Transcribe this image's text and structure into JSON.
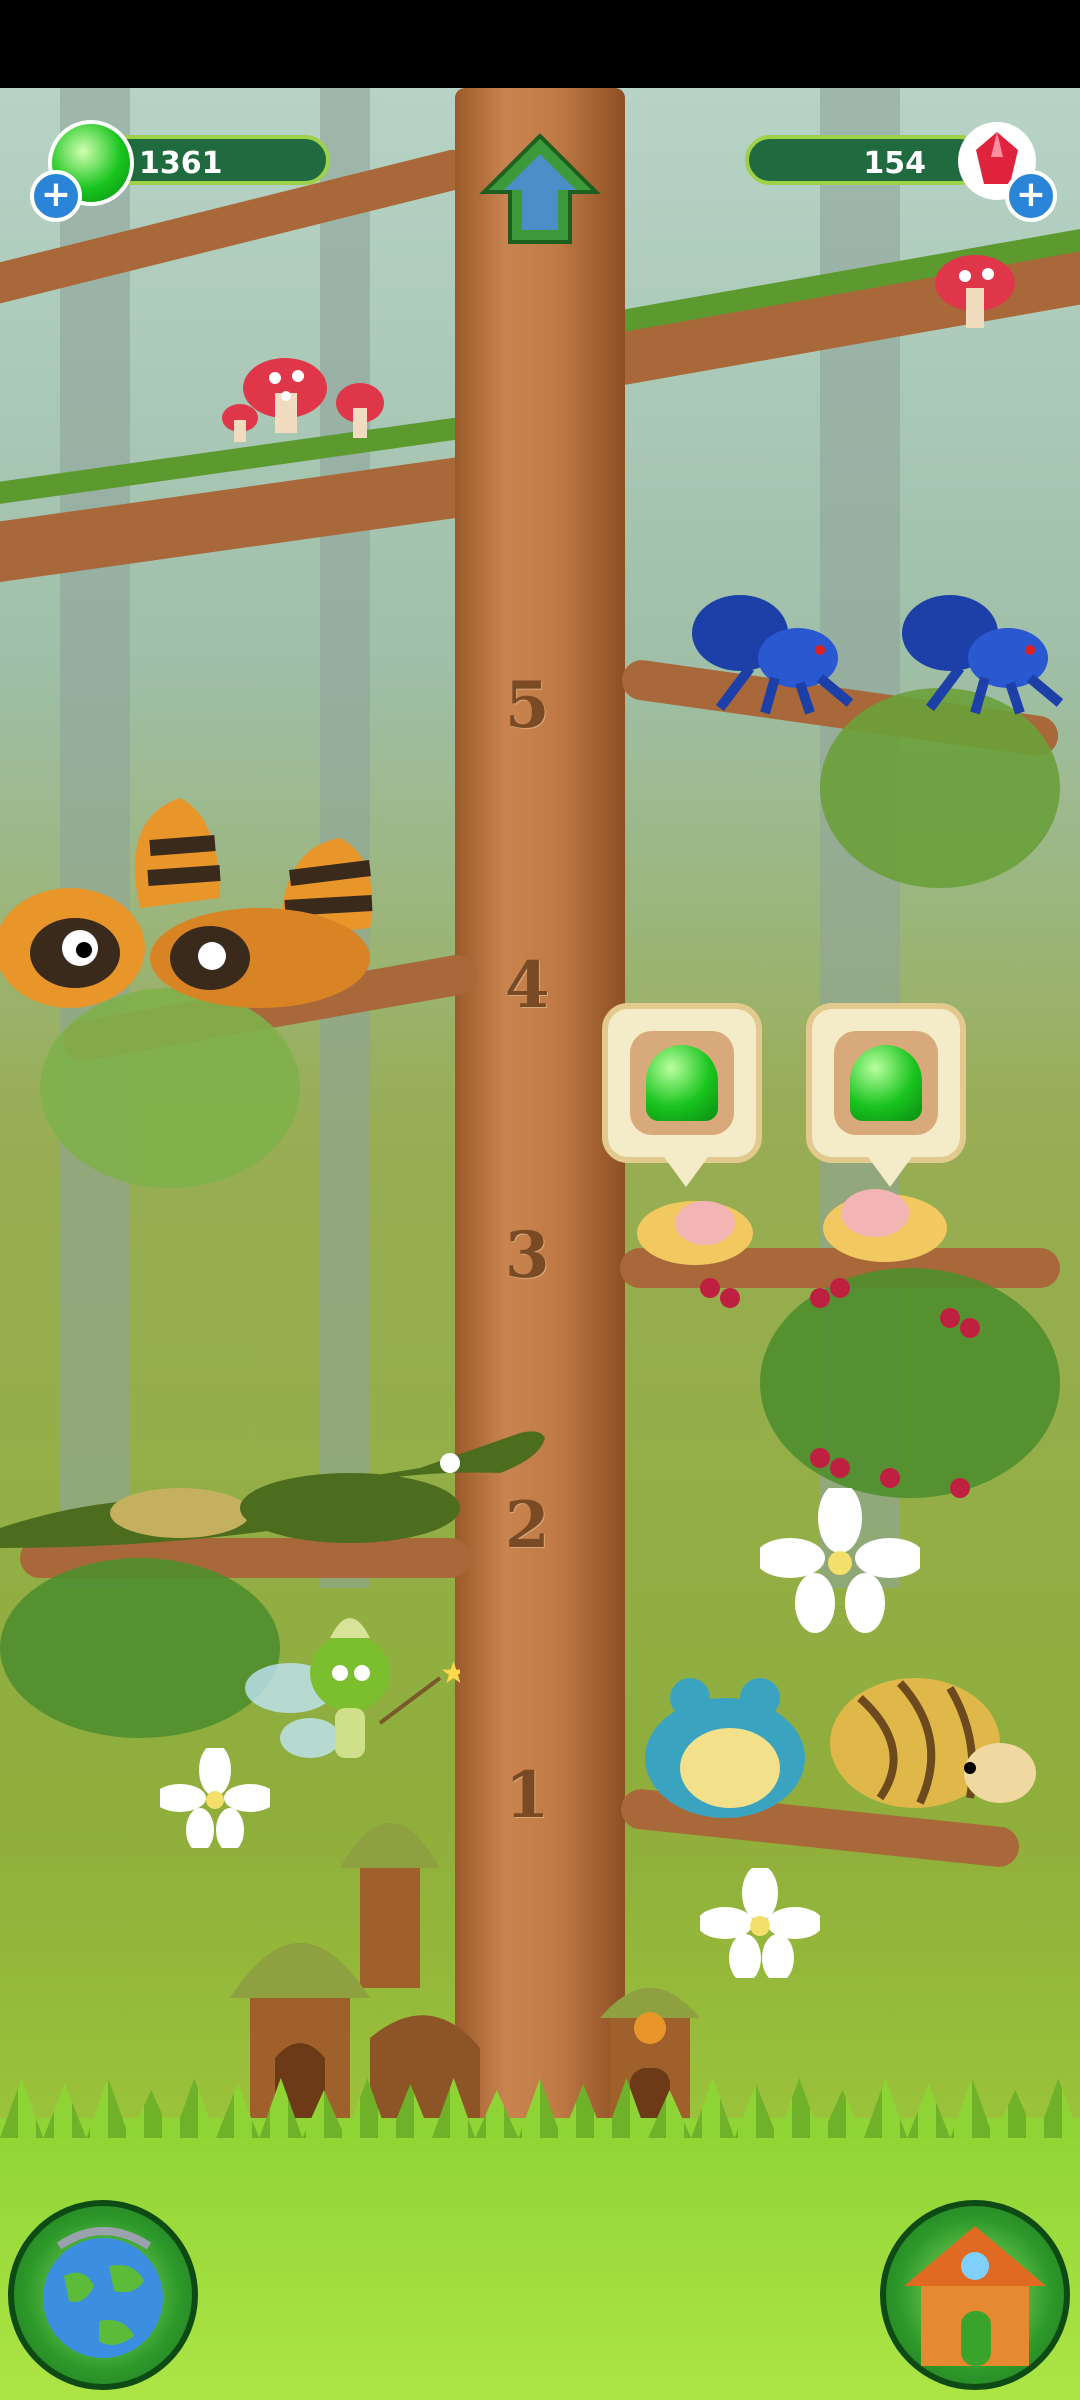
{
  "hud": {
    "jelly_count": "1361",
    "gem_count": "154",
    "jelly_plus": "+",
    "gem_plus": "+"
  },
  "tree": {
    "levels": [
      "5",
      "4",
      "3",
      "2",
      "1"
    ]
  },
  "colors": {
    "jelly": "#19c41e",
    "gem": "#e0233c",
    "trunk": "#c07a45",
    "grass": "#a6d63a"
  },
  "icons": {
    "globe": "globe-icon",
    "house": "house-icon",
    "upgrade": "up-arrow-icon"
  }
}
